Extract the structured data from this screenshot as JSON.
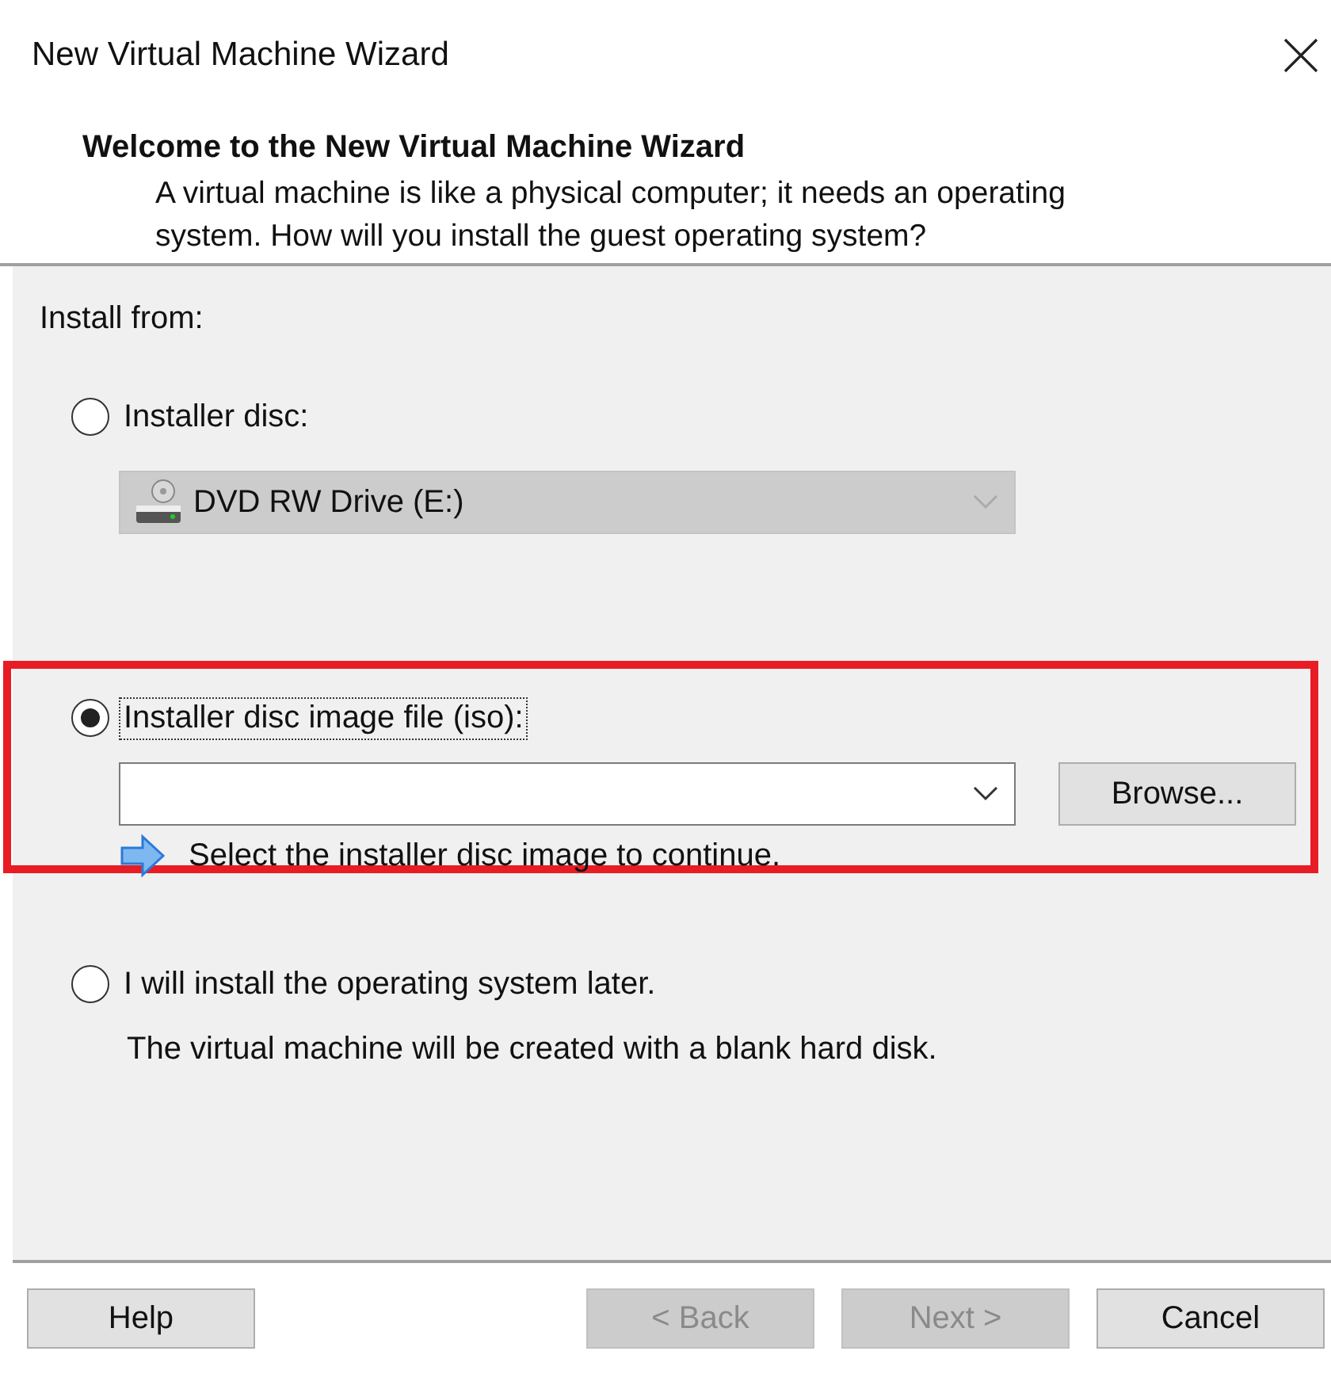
{
  "window": {
    "title": "New Virtual Machine Wizard"
  },
  "header": {
    "title": "Welcome to the New Virtual Machine Wizard",
    "description": "A virtual machine is like a physical computer; it needs an operating system. How will you install the guest operating system?"
  },
  "install_from_label": "Install from:",
  "options": [
    {
      "kind": "disc",
      "label": "Installer disc:",
      "selected": false,
      "focused": false,
      "highlighted": false,
      "drive": {
        "value": "DVD RW Drive (E:)",
        "disabled": true
      }
    },
    {
      "kind": "iso",
      "label": "Installer disc image file (iso):",
      "selected": true,
      "focused": true,
      "highlighted": true,
      "browse": "Browse...",
      "hint": "Select the installer disc image to continue."
    },
    {
      "kind": "later",
      "label": "I will install the operating system later.",
      "selected": false,
      "focused": false,
      "highlighted": false,
      "note": "The virtual machine will be created with a blank hard disk."
    }
  ],
  "buttons": [
    {
      "label": "Help",
      "disabled": false
    },
    {
      "label": "< Back",
      "disabled": true
    },
    {
      "label": "Next >",
      "disabled": true
    },
    {
      "label": "Cancel",
      "disabled": false
    }
  ]
}
